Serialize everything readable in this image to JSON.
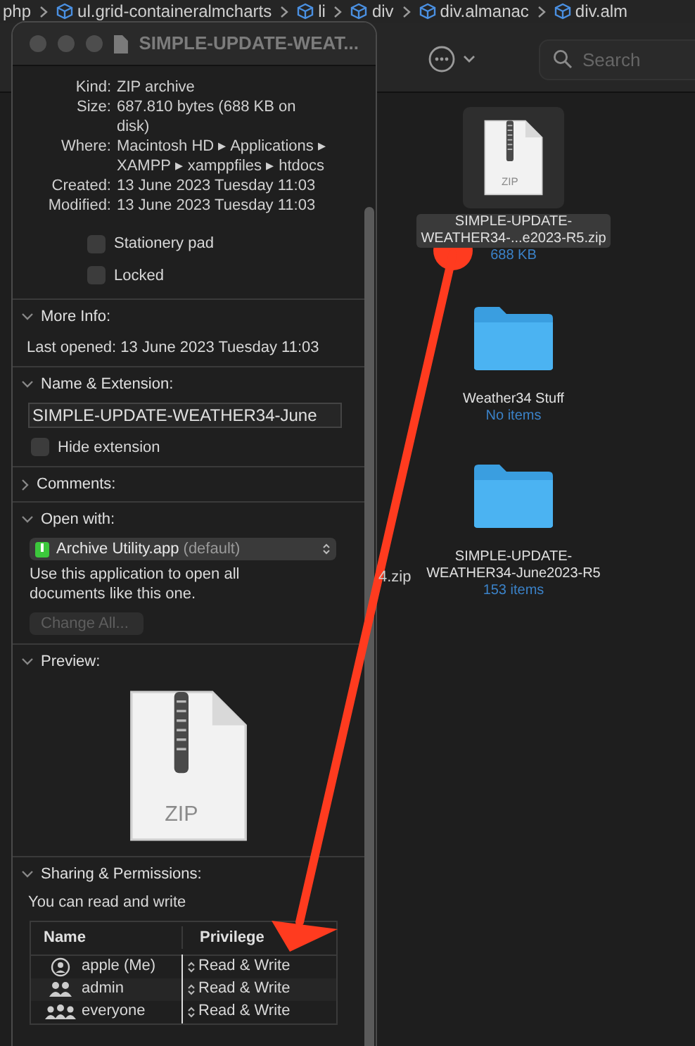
{
  "breadcrumb": [
    {
      "label": "php"
    },
    {
      "label": "ul.grid-containeralmcharts"
    },
    {
      "label": "li"
    },
    {
      "label": "div"
    },
    {
      "label": "div.almanac"
    },
    {
      "label": "div.alm"
    }
  ],
  "toolbar": {
    "search": {
      "placeholder": "Search"
    }
  },
  "files": [
    {
      "kind": "zip",
      "icon_label": "ZIP",
      "name_lines": [
        "SIMPLE-UPDATE-",
        "WEATHER34-...e2023-R5.zip"
      ],
      "detail": "688 KB",
      "selected": true
    },
    {
      "kind": "folder",
      "name_lines": [
        "Weather34 Stuff"
      ],
      "detail": "No items",
      "selected": false
    },
    {
      "kind": "folder",
      "name_lines": [
        "SIMPLE-UPDATE-",
        "WEATHER34-June2023-R5"
      ],
      "detail": "153 items",
      "selected": false
    }
  ],
  "hidden_file": {
    "name": "4.zip"
  },
  "info_window": {
    "title": "SIMPLE-UPDATE-WEAT...",
    "general": [
      {
        "label": "Kind:",
        "value": "ZIP archive"
      },
      {
        "label": "Size:",
        "value": "687.810 bytes (688 KB on disk)"
      },
      {
        "label": "Where:",
        "value": "Macintosh HD ▸ Applications ▸ XAMPP ▸ xamppfiles ▸ htdocs"
      },
      {
        "label": "Created:",
        "value": "13 June 2023 Tuesday 11:03"
      },
      {
        "label": "Modified:",
        "value": "13 June 2023 Tuesday 11:03"
      }
    ],
    "options": [
      {
        "label": "Stationery pad",
        "checked": false
      },
      {
        "label": "Locked",
        "checked": false
      }
    ],
    "more_info": {
      "title": "More Info:",
      "expanded": true,
      "last_opened": "Last opened: 13 June 2023 Tuesday 11:03"
    },
    "name_extension": {
      "title": "Name & Extension:",
      "expanded": true,
      "value": "SIMPLE-UPDATE-WEATHER34-June",
      "hide_extension": {
        "label": "Hide extension",
        "checked": false
      }
    },
    "comments": {
      "title": "Comments:",
      "expanded": false
    },
    "open_with": {
      "title": "Open with:",
      "expanded": true,
      "app": "Archive Utility.app",
      "app_note": "(default)",
      "description": "Use this application to open all documents like this one.",
      "button": {
        "label": "Change All...",
        "disabled": true
      }
    },
    "preview": {
      "title": "Preview:",
      "expanded": true,
      "icon_label": "ZIP"
    },
    "sharing": {
      "title": "Sharing & Permissions:",
      "expanded": true,
      "summary": "You can read and write",
      "columns": [
        "Name",
        "Privilege"
      ],
      "rows": [
        {
          "kind": "user",
          "name": "apple (Me)",
          "privilege": "Read & Write"
        },
        {
          "kind": "group",
          "name": "admin",
          "privilege": "Read & Write"
        },
        {
          "kind": "everyone",
          "name": "everyone",
          "privilege": "Read & Write"
        }
      ]
    }
  }
}
